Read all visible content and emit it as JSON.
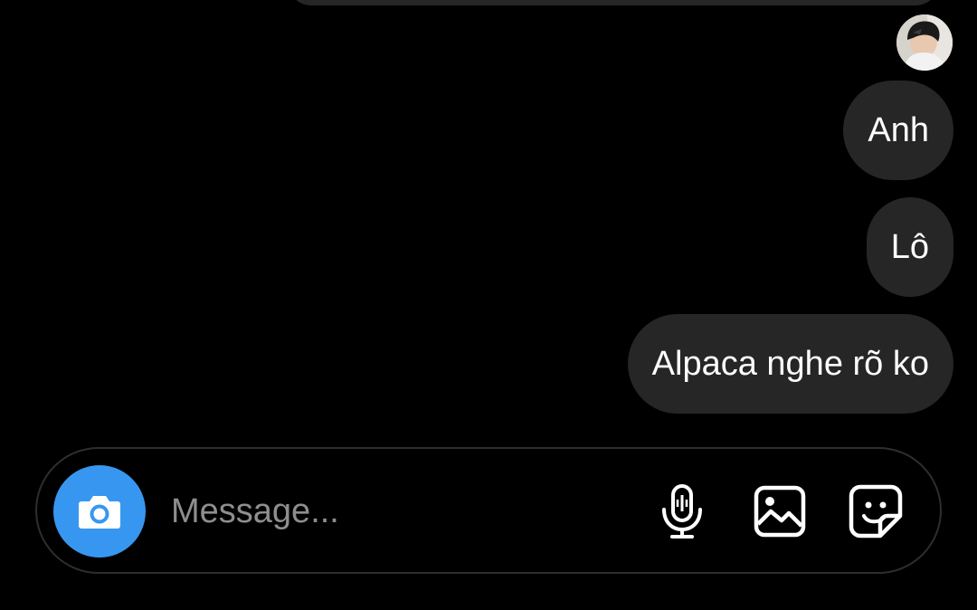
{
  "thread": {
    "messages": [
      {
        "text": "Anh"
      },
      {
        "text": "Lô"
      },
      {
        "text": "Alpaca nghe rõ ko"
      }
    ]
  },
  "composer": {
    "placeholder": "Message...",
    "value": "",
    "camera_icon": "camera-icon",
    "mic_icon": "microphone-icon",
    "gallery_icon": "image-gallery-icon",
    "sticker_icon": "sticker-icon"
  },
  "colors": {
    "background": "#000000",
    "bubble": "#262626",
    "accent": "#3797f0",
    "placeholder": "#8e8e8e"
  }
}
